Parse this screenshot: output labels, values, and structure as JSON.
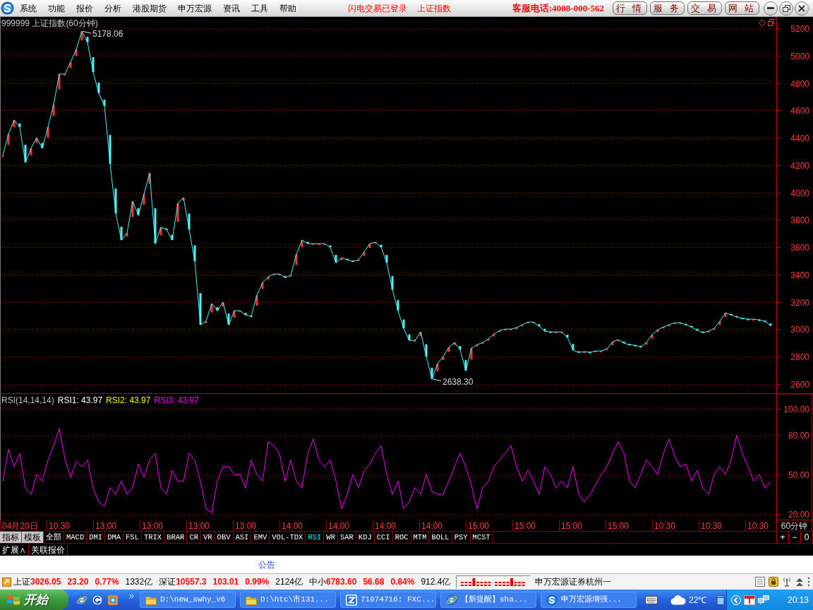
{
  "menu_bar": {
    "items": [
      "系统",
      "功能",
      "报价",
      "分析",
      "港股期货",
      "申万宏源",
      "资讯",
      "工具",
      "帮助"
    ],
    "login_status": "闪电交易已登录",
    "current_index": "上证指数",
    "hotline": "客服电话:4008-000-562",
    "buttons": [
      "行 情",
      "服 务",
      "交 易",
      "网 站"
    ]
  },
  "price_chart": {
    "chart_data": {
      "type": "line",
      "title": "999999 上证指数(60分钟)",
      "ylim": [
        2600,
        5200
      ],
      "yticks": [
        2600,
        2800,
        3000,
        3200,
        3400,
        3600,
        3800,
        4000,
        4200,
        4400,
        4600,
        4800,
        5000,
        5200
      ],
      "grid": true,
      "values": [
        4271,
        4426,
        4529,
        4478,
        4220,
        4323,
        4400,
        4323,
        4478,
        4643,
        4865,
        4865,
        4952,
        5045,
        5178,
        5097,
        4880,
        4725,
        4632,
        4209,
        3848,
        3652,
        3704,
        3936,
        3833,
        3987,
        4142,
        3626,
        3745,
        3729,
        3652,
        3920,
        3962,
        3729,
        3497,
        3033,
        3059,
        3188,
        3136,
        3198,
        3033,
        3136,
        3136,
        3105,
        3095,
        3250,
        3342,
        3384,
        3404,
        3404,
        3378,
        3394,
        3549,
        3652,
        3626,
        3626,
        3626,
        3626,
        3600,
        3487,
        3523,
        3508,
        3497,
        3508,
        3564,
        3626,
        3637,
        3600,
        3487,
        3291,
        3136,
        3007,
        2919,
        2919,
        2981,
        2801,
        2638,
        2749,
        2801,
        2868,
        2904,
        2852,
        2697,
        2862,
        2888,
        2904,
        2930,
        2966,
        2992,
        3002,
        3002,
        3012,
        3033,
        3053,
        3053,
        3022,
        2986,
        2981,
        2981,
        2981,
        2940,
        2847,
        2832,
        2837,
        2832,
        2842,
        2842,
        2857,
        2909,
        2924,
        2899,
        2888,
        2883,
        2873,
        2904,
        2961,
        2997,
        3017,
        3033,
        3048,
        3048,
        3033,
        3017,
        2992,
        2976,
        2986,
        3007,
        3059,
        3120,
        3105,
        3090,
        3079,
        3074,
        3074,
        3069,
        3059,
        3026
      ],
      "annotations": [
        "5178.06",
        "2638.30"
      ]
    }
  },
  "rsi_panel": {
    "title": "RSI(14,14,14)",
    "legend": [
      {
        "text": "RSI1: 43.97",
        "color": "#ffffff"
      },
      {
        "text": "RSI2: 43.97",
        "color": "#ffff00"
      },
      {
        "text": "RSI3: 43.97",
        "color": "#ff00ff"
      }
    ],
    "chart_data": {
      "type": "line",
      "ylim": [
        20,
        100
      ],
      "yticks": [
        {
          "value": 20,
          "label": "20.00"
        },
        {
          "value": 50,
          "label": "50.00"
        },
        {
          "value": 80,
          "label": "80.00"
        },
        {
          "value": 100,
          "label": "100.00"
        }
      ],
      "grid": true,
      "series": [
        {
          "color": "#ff00ff",
          "values": [
            45,
            69,
            56,
            66,
            40,
            35,
            50,
            45,
            61,
            72,
            85,
            62,
            48,
            60,
            56,
            61,
            40,
            29,
            26,
            40,
            35,
            45,
            35,
            40,
            58,
            48,
            61,
            66,
            40,
            35,
            53,
            45,
            45,
            66,
            61,
            45,
            24,
            21,
            45,
            56,
            56,
            50,
            50,
            40,
            61,
            50,
            45,
            75,
            72,
            66,
            45,
            61,
            45,
            40,
            66,
            77,
            61,
            56,
            61,
            45,
            24,
            35,
            50,
            40,
            53,
            58,
            66,
            72,
            50,
            35,
            45,
            24,
            29,
            40,
            35,
            50,
            37,
            35,
            35,
            45,
            56,
            66,
            56,
            42,
            24,
            40,
            45,
            56,
            61,
            66,
            72,
            56,
            45,
            53,
            45,
            35,
            56,
            50,
            40,
            45,
            40,
            56,
            35,
            29,
            35,
            42,
            50,
            56,
            66,
            75,
            66,
            45,
            40,
            50,
            61,
            56,
            50,
            66,
            77,
            64,
            56,
            58,
            45,
            53,
            40,
            35,
            50,
            56,
            50,
            61,
            80,
            66,
            56,
            45,
            50,
            40,
            44
          ]
        }
      ]
    }
  },
  "time_axis": {
    "labels": [
      "04月20日",
      "10:30",
      "13:00",
      "13:00",
      "13:00",
      "13:00",
      "14:00",
      "14:00",
      "14:00",
      "14:00",
      "15:00",
      "15:00",
      "15:00",
      "15:00",
      "10:30",
      "10:30",
      "10:30"
    ],
    "period": "60分钟"
  },
  "indicator_bar": {
    "tools": [
      "指标",
      "模板"
    ],
    "tabs": [
      {
        "label": "全部",
        "selected": false
      },
      {
        "label": "MACD",
        "selected": false
      },
      {
        "label": "DMI",
        "selected": false
      },
      {
        "label": "DMA",
        "selected": false
      },
      {
        "label": "FSL",
        "selected": false
      },
      {
        "label": "TRIX",
        "selected": false
      },
      {
        "label": "BRAR",
        "selected": false
      },
      {
        "label": "CR",
        "selected": false
      },
      {
        "label": "VR",
        "selected": false
      },
      {
        "label": "OBV",
        "selected": false
      },
      {
        "label": "ASI",
        "selected": false
      },
      {
        "label": "EMV",
        "selected": false
      },
      {
        "label": "VOL-TDX",
        "selected": false
      },
      {
        "label": "RSI",
        "selected": true
      },
      {
        "label": "WR",
        "selected": false
      },
      {
        "label": "SAR",
        "selected": false
      },
      {
        "label": "KDJ",
        "selected": false
      },
      {
        "label": "CCI",
        "selected": false
      },
      {
        "label": "ROC",
        "selected": false
      },
      {
        "label": "MTM",
        "selected": false
      },
      {
        "label": "BOLL",
        "selected": false
      },
      {
        "label": "PSY",
        "selected": false
      },
      {
        "label": "MCST",
        "selected": false
      }
    ],
    "zoom_buttons": [
      "+",
      "−",
      "0"
    ]
  },
  "extra_bar": {
    "buttons": [
      "扩展∧",
      "关联报价"
    ]
  },
  "notice": "公告",
  "status_bar": {
    "indices": [
      {
        "name": "上证",
        "value": "3026.05",
        "change": "23.20",
        "percent": "0.77%",
        "turnover": "1332亿"
      },
      {
        "name": "深证",
        "value": "10557.3",
        "change": "103.01",
        "percent": "0.99%",
        "turnover": "2124亿"
      },
      {
        "name": "中小",
        "value": "6783.60",
        "change": "56.68",
        "percent": "0.84%",
        "turnover": "912.4亿"
      }
    ],
    "broker": "申万宏源证券杭州一"
  },
  "taskbar": {
    "start": "开始",
    "tasks": [
      {
        "label": "D:\\new_swhy_v6",
        "kind": "folder",
        "selected": false
      },
      {
        "label": "D:\\htc\\市131...",
        "kind": "folder",
        "selected": false
      },
      {
        "label": "71074716: FXC...",
        "kind": "tile",
        "selected": false
      },
      {
        "label": "【新提醒】sha...",
        "kind": "browser",
        "selected": false
      },
      {
        "label": "申万宏源增强...",
        "kind": "logo",
        "selected": false
      }
    ],
    "weather": "22℃",
    "clock": "20:13"
  }
}
